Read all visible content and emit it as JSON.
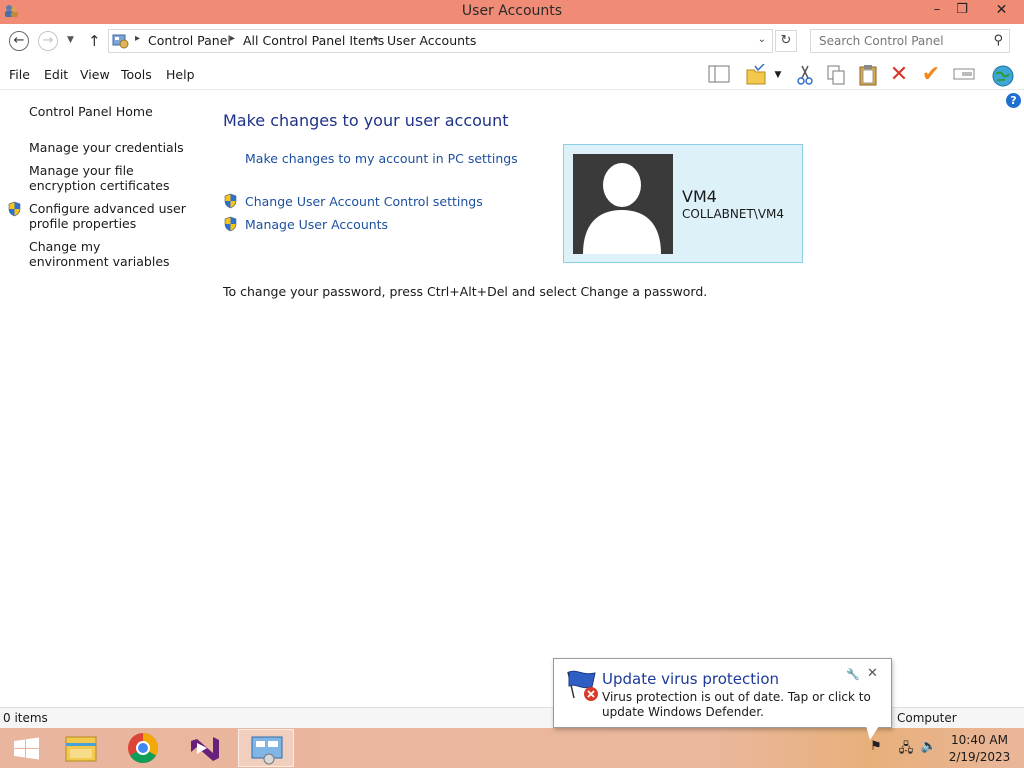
{
  "window": {
    "title": "User Accounts",
    "controls": {
      "minimize": "–",
      "maximize": "❐",
      "close": "✕"
    }
  },
  "address_bar": {
    "breadcrumbs": [
      "Control Panel",
      "All Control Panel Items",
      "User Accounts"
    ],
    "search_placeholder": "Search Control Panel"
  },
  "menu": [
    "File",
    "Edit",
    "View",
    "Tools",
    "Help"
  ],
  "toolbar_icons": [
    "layout-pane-icon",
    "folder-properties-icon",
    "cut-icon",
    "copy-icon",
    "paste-icon",
    "delete-icon",
    "check-icon",
    "rename-icon",
    "globe-icon"
  ],
  "left_pane": {
    "home": "Control Panel Home",
    "credentials": "Manage your credentials",
    "file_encryption": "Manage your file encryption certificates",
    "advanced_profile": "Configure advanced user profile properties",
    "environment": "Change my environment variables"
  },
  "main": {
    "title": "Make changes to your user account",
    "pc_settings_link": "Make changes to my account in PC settings",
    "uac_link": "Change User Account Control settings",
    "manage_accounts_link": "Manage User Accounts",
    "password_note": "To change your password, press Ctrl+Alt+Del and select Change a password."
  },
  "account": {
    "name": "VM4",
    "domain": "COLLABNET\\VM4"
  },
  "status_bar": {
    "item_count": "0 items",
    "zone": "Computer"
  },
  "notification": {
    "title": "Update virus protection",
    "message": "Virus protection is out of date. Tap or click to update Windows Defender."
  },
  "taskbar": {
    "apps": [
      "start-button",
      "file-explorer",
      "chrome",
      "visual-studio",
      "control-panel"
    ],
    "clock_time": "10:40 AM",
    "clock_date": "2/19/2023"
  },
  "colors": {
    "titlebar": "#f08c76",
    "link": "#1e50a0",
    "heading": "#1e3287",
    "tile_bg": "#ddf1f9",
    "tile_border": "#8fcce6"
  }
}
